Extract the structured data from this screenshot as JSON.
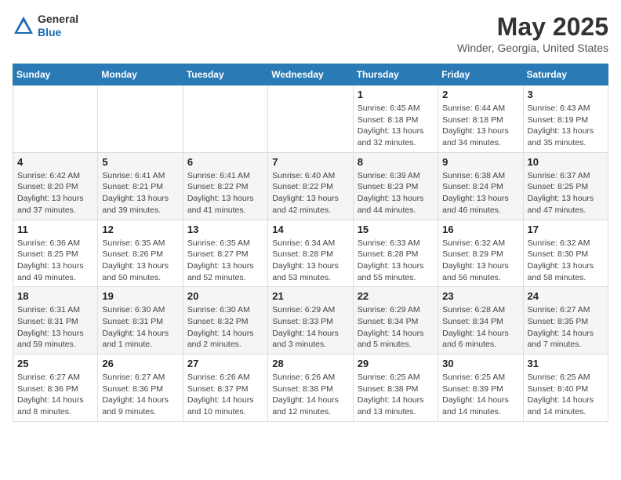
{
  "header": {
    "logo_general": "General",
    "logo_blue": "Blue",
    "main_title": "May 2025",
    "subtitle": "Winder, Georgia, United States"
  },
  "days_of_week": [
    "Sunday",
    "Monday",
    "Tuesday",
    "Wednesday",
    "Thursday",
    "Friday",
    "Saturday"
  ],
  "weeks": [
    {
      "days": [
        {
          "number": "",
          "info": ""
        },
        {
          "number": "",
          "info": ""
        },
        {
          "number": "",
          "info": ""
        },
        {
          "number": "",
          "info": ""
        },
        {
          "number": "1",
          "info": "Sunrise: 6:45 AM\nSunset: 8:18 PM\nDaylight: 13 hours\nand 32 minutes."
        },
        {
          "number": "2",
          "info": "Sunrise: 6:44 AM\nSunset: 8:18 PM\nDaylight: 13 hours\nand 34 minutes."
        },
        {
          "number": "3",
          "info": "Sunrise: 6:43 AM\nSunset: 8:19 PM\nDaylight: 13 hours\nand 35 minutes."
        }
      ]
    },
    {
      "days": [
        {
          "number": "4",
          "info": "Sunrise: 6:42 AM\nSunset: 8:20 PM\nDaylight: 13 hours\nand 37 minutes."
        },
        {
          "number": "5",
          "info": "Sunrise: 6:41 AM\nSunset: 8:21 PM\nDaylight: 13 hours\nand 39 minutes."
        },
        {
          "number": "6",
          "info": "Sunrise: 6:41 AM\nSunset: 8:22 PM\nDaylight: 13 hours\nand 41 minutes."
        },
        {
          "number": "7",
          "info": "Sunrise: 6:40 AM\nSunset: 8:22 PM\nDaylight: 13 hours\nand 42 minutes."
        },
        {
          "number": "8",
          "info": "Sunrise: 6:39 AM\nSunset: 8:23 PM\nDaylight: 13 hours\nand 44 minutes."
        },
        {
          "number": "9",
          "info": "Sunrise: 6:38 AM\nSunset: 8:24 PM\nDaylight: 13 hours\nand 46 minutes."
        },
        {
          "number": "10",
          "info": "Sunrise: 6:37 AM\nSunset: 8:25 PM\nDaylight: 13 hours\nand 47 minutes."
        }
      ]
    },
    {
      "days": [
        {
          "number": "11",
          "info": "Sunrise: 6:36 AM\nSunset: 8:25 PM\nDaylight: 13 hours\nand 49 minutes."
        },
        {
          "number": "12",
          "info": "Sunrise: 6:35 AM\nSunset: 8:26 PM\nDaylight: 13 hours\nand 50 minutes."
        },
        {
          "number": "13",
          "info": "Sunrise: 6:35 AM\nSunset: 8:27 PM\nDaylight: 13 hours\nand 52 minutes."
        },
        {
          "number": "14",
          "info": "Sunrise: 6:34 AM\nSunset: 8:28 PM\nDaylight: 13 hours\nand 53 minutes."
        },
        {
          "number": "15",
          "info": "Sunrise: 6:33 AM\nSunset: 8:28 PM\nDaylight: 13 hours\nand 55 minutes."
        },
        {
          "number": "16",
          "info": "Sunrise: 6:32 AM\nSunset: 8:29 PM\nDaylight: 13 hours\nand 56 minutes."
        },
        {
          "number": "17",
          "info": "Sunrise: 6:32 AM\nSunset: 8:30 PM\nDaylight: 13 hours\nand 58 minutes."
        }
      ]
    },
    {
      "days": [
        {
          "number": "18",
          "info": "Sunrise: 6:31 AM\nSunset: 8:31 PM\nDaylight: 13 hours\nand 59 minutes."
        },
        {
          "number": "19",
          "info": "Sunrise: 6:30 AM\nSunset: 8:31 PM\nDaylight: 14 hours\nand 1 minute."
        },
        {
          "number": "20",
          "info": "Sunrise: 6:30 AM\nSunset: 8:32 PM\nDaylight: 14 hours\nand 2 minutes."
        },
        {
          "number": "21",
          "info": "Sunrise: 6:29 AM\nSunset: 8:33 PM\nDaylight: 14 hours\nand 3 minutes."
        },
        {
          "number": "22",
          "info": "Sunrise: 6:29 AM\nSunset: 8:34 PM\nDaylight: 14 hours\nand 5 minutes."
        },
        {
          "number": "23",
          "info": "Sunrise: 6:28 AM\nSunset: 8:34 PM\nDaylight: 14 hours\nand 6 minutes."
        },
        {
          "number": "24",
          "info": "Sunrise: 6:27 AM\nSunset: 8:35 PM\nDaylight: 14 hours\nand 7 minutes."
        }
      ]
    },
    {
      "days": [
        {
          "number": "25",
          "info": "Sunrise: 6:27 AM\nSunset: 8:36 PM\nDaylight: 14 hours\nand 8 minutes."
        },
        {
          "number": "26",
          "info": "Sunrise: 6:27 AM\nSunset: 8:36 PM\nDaylight: 14 hours\nand 9 minutes."
        },
        {
          "number": "27",
          "info": "Sunrise: 6:26 AM\nSunset: 8:37 PM\nDaylight: 14 hours\nand 10 minutes."
        },
        {
          "number": "28",
          "info": "Sunrise: 6:26 AM\nSunset: 8:38 PM\nDaylight: 14 hours\nand 12 minutes."
        },
        {
          "number": "29",
          "info": "Sunrise: 6:25 AM\nSunset: 8:38 PM\nDaylight: 14 hours\nand 13 minutes."
        },
        {
          "number": "30",
          "info": "Sunrise: 6:25 AM\nSunset: 8:39 PM\nDaylight: 14 hours\nand 14 minutes."
        },
        {
          "number": "31",
          "info": "Sunrise: 6:25 AM\nSunset: 8:40 PM\nDaylight: 14 hours\nand 14 minutes."
        }
      ]
    }
  ]
}
